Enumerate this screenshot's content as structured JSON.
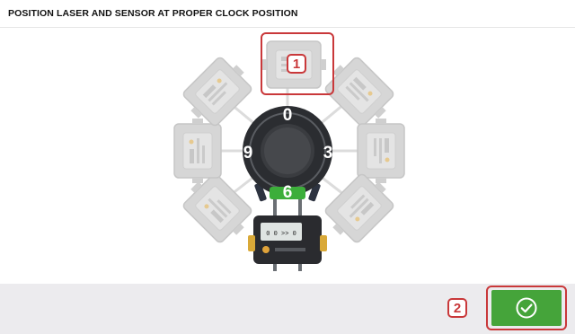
{
  "header": {
    "title": "POSITION LASER AND SENSOR AT PROPER CLOCK POSITION"
  },
  "clock": {
    "labels": {
      "top": "0",
      "right": "3",
      "bottom": "6",
      "left": "9"
    },
    "active_position": "6"
  },
  "device": {
    "display_text": "0 0 >> 0"
  },
  "callouts": [
    {
      "number": "1",
      "target": "sensor-at-12-oclock"
    },
    {
      "number": "2",
      "target": "confirm-button"
    }
  ],
  "footer": {
    "confirm_icon": "check-circle-icon"
  },
  "colors": {
    "accent_green": "#45a43a",
    "callout_red": "#c9383a",
    "bar_gray": "#ecebee"
  }
}
